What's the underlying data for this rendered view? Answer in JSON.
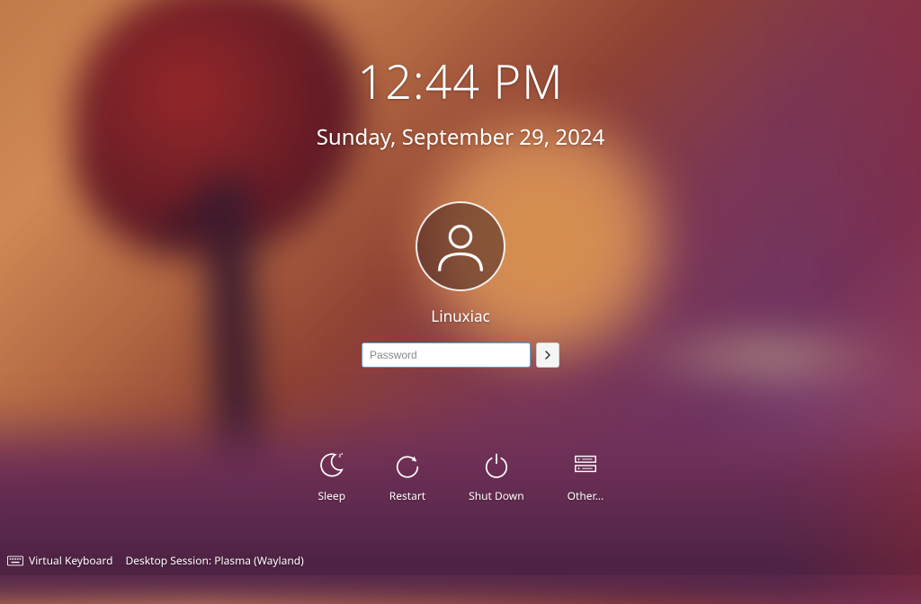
{
  "clock": {
    "time": "12:44 PM",
    "date": "Sunday, September 29, 2024"
  },
  "user": {
    "name": "Linuxiac"
  },
  "login": {
    "password_placeholder": "Password"
  },
  "power": {
    "sleep": "Sleep",
    "restart": "Restart",
    "shutdown": "Shut Down",
    "other": "Other..."
  },
  "bottom": {
    "virtual_keyboard": "Virtual Keyboard",
    "session_prefix": "Desktop Session: ",
    "session_name": "Plasma (Wayland)"
  }
}
